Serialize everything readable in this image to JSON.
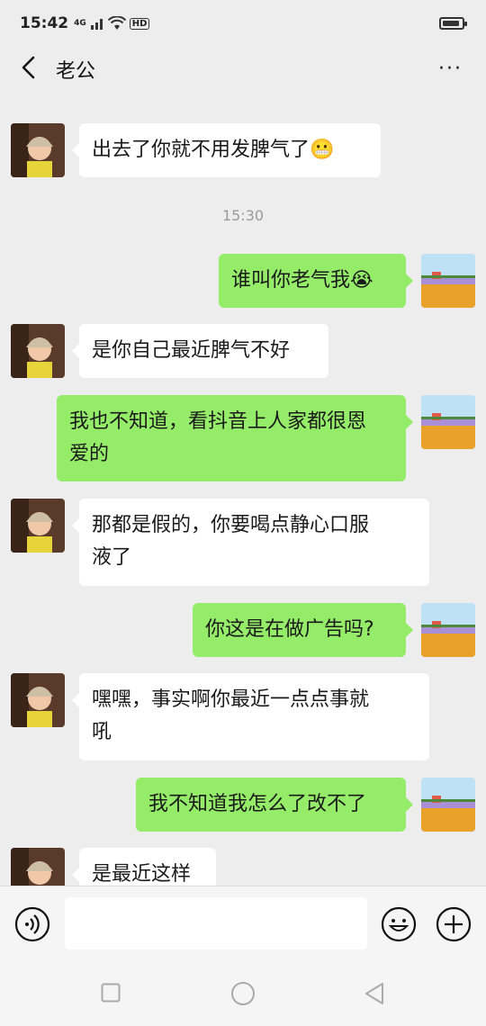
{
  "status": {
    "time": "15:42",
    "network": "4G",
    "hd": "HD"
  },
  "header": {
    "title": "老公",
    "more": "···"
  },
  "messages": [
    {
      "side": "left",
      "text": "出去了你就不用发脾气了😬"
    },
    {
      "timestamp": "15:30"
    },
    {
      "side": "right",
      "text": "谁叫你老气我😭"
    },
    {
      "side": "left",
      "text": "是你自己最近脾气不好"
    },
    {
      "side": "right",
      "line1": "我也不知道，看抖音上人家都很恩",
      "line2": "爱的"
    },
    {
      "side": "left",
      "line1": "那都是假的，你要喝点静心口服",
      "line2": "液了"
    },
    {
      "side": "right",
      "text": "你这是在做广告吗?"
    },
    {
      "side": "left",
      "line1": "嘿嘿，事实啊你最近一点点事就",
      "line2": "吼"
    },
    {
      "side": "right",
      "text": "我不知道我怎么了改不了"
    },
    {
      "side": "left",
      "text": "是最近这样"
    }
  ],
  "colors": {
    "background": "#ededed",
    "right_bubble": "#95ec69",
    "left_bubble": "#ffffff"
  },
  "icons": [
    "back-arrow-icon",
    "more-icon",
    "voice-icon",
    "emoji-icon",
    "plus-icon",
    "square-icon",
    "circle-icon",
    "triangle-back-icon"
  ]
}
